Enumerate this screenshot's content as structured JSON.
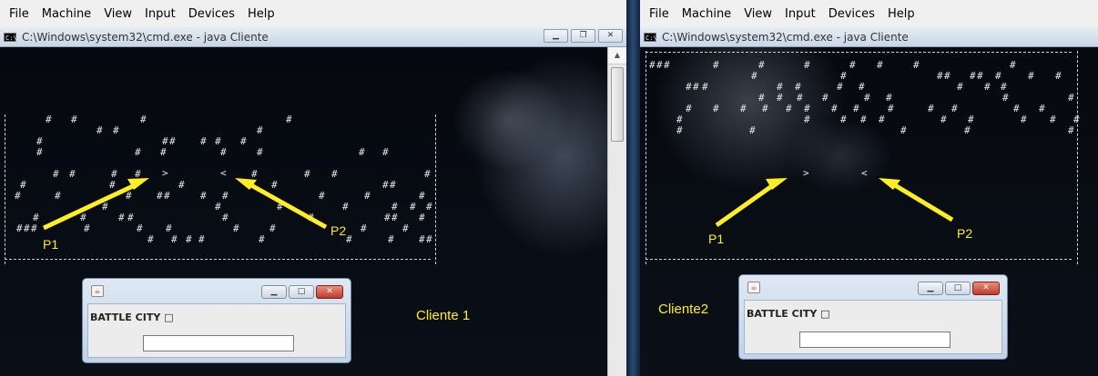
{
  "menu": [
    "File",
    "Machine",
    "View",
    "Input",
    "Devices",
    "Help"
  ],
  "console_title": "C:\\Windows\\system32\\cmd.exe - java  Cliente",
  "labels": {
    "p1": "P1",
    "p2": "P2",
    "cliente1": "Cliente 1",
    "cliente2": "Cliente2"
  },
  "players": {
    "p1": ">",
    "p2": "<"
  },
  "dialog": {
    "title_text": "BATTLE CITY □",
    "input_value": ""
  },
  "colors": {
    "annotation": "#ffee22",
    "menubar": "#f0f0f0",
    "console_bg": "#000000",
    "dialog_frame": "#c2d3e8",
    "close_button": "#c0392b"
  },
  "icons": [
    "cmd-icon",
    "minimize-icon",
    "restore-icon",
    "close-icon",
    "java-icon",
    "scroll-up-icon"
  ]
}
